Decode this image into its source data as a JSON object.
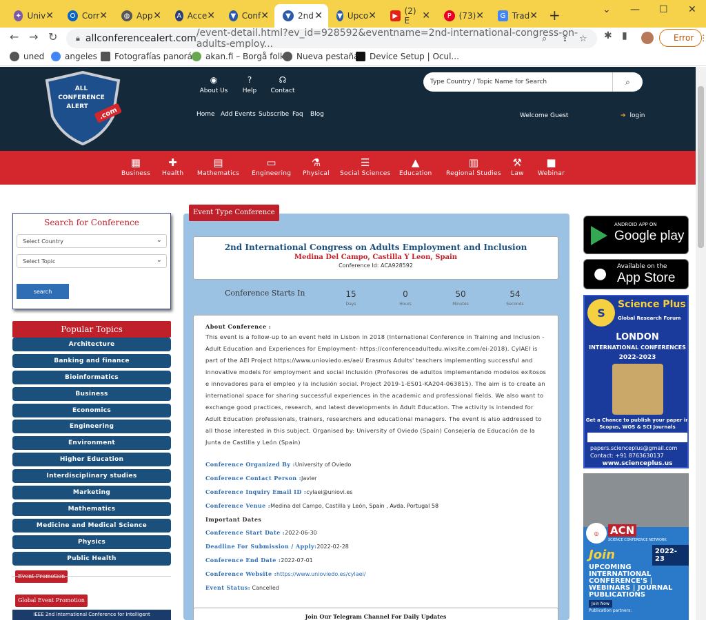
{
  "browser": {
    "tabs": [
      {
        "label": "Univ",
        "color": "#7b5ba8"
      },
      {
        "label": "Corr",
        "color": "#0a66c2"
      },
      {
        "label": "App",
        "color": "#555555"
      },
      {
        "label": "Acce",
        "color": "#2a3f7a"
      },
      {
        "label": "Conf",
        "color": "#2b5aa8"
      },
      {
        "label": "2nd",
        "color": "#2b5aa8"
      },
      {
        "label": "Upco",
        "color": "#2b5aa8"
      },
      {
        "label": "(2) E",
        "color": "#e62117"
      },
      {
        "label": "(73)",
        "color": "#e60023"
      },
      {
        "label": "Trad",
        "color": "#4285f4"
      }
    ],
    "url_domain": "allconferencealert.com",
    "url_rest": "/event-detail.html?ev_id=928592&eventname=2nd-international-congress-on-adults-employ...",
    "error_label": "Error",
    "bookmarks": [
      "uned",
      "angeles",
      "Fotografías panorá...",
      "akan.fi – Borgå folk...",
      "Nueva pestaña",
      "Device Setup | Ocul..."
    ]
  },
  "header": {
    "logo_text": [
      "ALL",
      "CONFERENCE",
      "ALERT",
      ".com"
    ],
    "top_links": [
      "About Us",
      "Help",
      "Contact"
    ],
    "menu": [
      "Home",
      "Add Events",
      "Subscribe",
      "Faq",
      "Blog"
    ],
    "search_placeholder": "Type Country / Topic Name for Search",
    "welcome": "Welcome Guest",
    "login": "login"
  },
  "categories": [
    "Business",
    "Health",
    "Mathematics",
    "Engineering",
    "Physical",
    "Social Sciences",
    "Education",
    "Regional Studies",
    "Law",
    "Webinar"
  ],
  "sidebar": {
    "search_title": "Search for Conference",
    "country_placeholder": "Select Country",
    "topic_placeholder": "Select Topic",
    "search_button": "search",
    "popular_title": "Popular Topics",
    "topics": [
      "Architecture",
      "Banking and finance",
      "Bioinformatics",
      "Business",
      "Economics",
      "Engineering",
      "Environment",
      "Higher Education",
      "Interdisciplinary studies",
      "Marketing",
      "Mathematics",
      "Medicine and Medical Science",
      "Physics",
      "Public Health"
    ],
    "event_promotion": "Event Promotion",
    "global_event_promotion": "Global Event Promotion",
    "ieee_item": "IEEE 2nd International Conference for Intelligent"
  },
  "event": {
    "type_tag": "Event Type Conference",
    "title": "2nd International Congress on Adults Employment and Inclusion",
    "location": "Medina Del Campo, Castilla Y Leon, Spain",
    "conference_id_label": "Conference Id:",
    "conference_id": "ACA928592",
    "starts_in_label": "Conference Starts In",
    "countdown": [
      {
        "value": "15",
        "unit": "Days"
      },
      {
        "value": "0",
        "unit": "Hours"
      },
      {
        "value": "50",
        "unit": "Minutes"
      },
      {
        "value": "54",
        "unit": "Seconds"
      }
    ],
    "about_heading": "About Conference :",
    "about_text": "This event is a follow-up to an event held in Lisbon in 2018 (International Conference in Training and Inclusion -Adult Education and Experiences for Employment- https://conferenceadultedu.wixsite.com/ei-2018). CylAEI is part of the AEI Project https://www.unioviedo.es/aei/ Erasmus Adults' teachers implementing successful and innovative models for employment and social inclusión (Profesores de adultos implementando modelos exitosos e innovadores para el empleo y la inclusión social. Project 2019-1-ES01-KA204-063815). The aim is to create an international space for sharing successful experiences in the academic and professional fields. We also want to exchange good practices, research, and latest developments in Adult Education. The activity is intended for Adult Education professionals, trainers, researchers and educational managers. The event is also addressed to all those interested in this subject. Organised by: University of Oviedo (Spain) Consejería de Educación de la Junta de Castilla y León (Spain)",
    "organized_by_label": "Conference Organized By :",
    "organized_by": "University of Oviedo",
    "contact_person_label": "Conference Contact Person :",
    "contact_person": "Javier",
    "email_label": "Conference Inquiry Email ID :",
    "email": "cylaei@uniovi.es",
    "venue_label": "Conference Venue :",
    "venue": "Medina del Campo, Castilla y León,",
    "venue_bold": "Spain , Avda. Portugal 58",
    "important_dates": "Important Dates",
    "start_date_label": "Conference Start Date :",
    "start_date": "2022-06-30",
    "deadline_label": "Deadline For Submission / Apply:",
    "deadline": "2022-02-28",
    "end_date_label": "Conference End Date :",
    "end_date": "2022-07-01",
    "website_label": "Conference Website :",
    "website": "https://www.unioviedo.es/cylaei/",
    "status_label": "Event Status:",
    "status": "Cancelled",
    "telegram": "Join Our Telegram Channel For Daily Updates"
  },
  "ads": {
    "google_play_small": "ANDROID APP ON",
    "google_play": "Google play",
    "app_store_small": "Available on the",
    "app_store": "App Store",
    "science_plus": "Science Plus",
    "science_plus_sub": "Global Research Forum",
    "london": "LONDON",
    "intl_conf": "INTERNATIONAL CONFERENCES",
    "years": "2022-2023",
    "publish": "Get a Chance to publish your paper in Scopus, WOS & SCI Journals",
    "email": "papers.scienceplus@gmail.com",
    "contact": "Contact: +91 8763630137",
    "site": "www.scienceplus.us",
    "acn": "ACN",
    "acn_sub": "SCIENCE CONFERENCE NETWORK",
    "acn_year": "2022-23",
    "join": "Join",
    "upcoming": "UPCOMING INTERNATIONAL CONFERENCE'S | WEBINARS | JOURNAL PUBLICATIONS",
    "join_now": "Join Now",
    "partners": "Publication partners:"
  }
}
